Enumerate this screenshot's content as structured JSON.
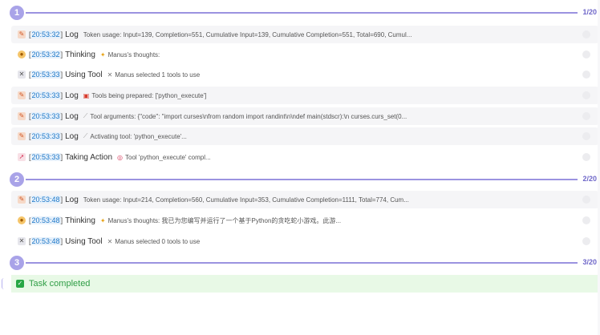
{
  "steps": [
    {
      "number": "1",
      "count": "1/20"
    },
    {
      "number": "2",
      "count": "2/20"
    },
    {
      "number": "3",
      "count": "3/20"
    }
  ],
  "rows": [
    {
      "time": "20:53:32",
      "kind": "Log",
      "icon": "log-icon",
      "msg_icon": "",
      "message": "Token usage: Input=139, Completion=551, Cumulative Input=139, Cumulative Completion=551, Total=690, Cumul..."
    },
    {
      "time": "20:53:32",
      "kind": "Thinking",
      "icon": "thinking-icon",
      "msg_icon": "sparkle-icon",
      "message": "Manus's thoughts:"
    },
    {
      "time": "20:53:33",
      "kind": "Using Tool",
      "icon": "tool-icon",
      "msg_icon": "tools-icon",
      "message": "Manus selected 1 tools to use"
    },
    {
      "time": "20:53:33",
      "kind": "Log",
      "icon": "log-icon",
      "msg_icon": "toolbox-icon",
      "message": "Tools being prepared: ['python_execute']"
    },
    {
      "time": "20:53:33",
      "kind": "Log",
      "icon": "log-icon",
      "msg_icon": "wand-icon",
      "message": "Tool arguments: {\"code\": \"import curses\\nfrom random import randint\\n\\ndef main(stdscr):\\n curses.curs_set(0..."
    },
    {
      "time": "20:53:33",
      "kind": "Log",
      "icon": "log-icon",
      "msg_icon": "wand-icon",
      "message": "Activating tool: 'python_execute'..."
    },
    {
      "time": "20:53:33",
      "kind": "Taking Action",
      "icon": "action-icon",
      "msg_icon": "target-icon",
      "message": "Tool 'python_execute' compl..."
    },
    {
      "time": "20:53:48",
      "kind": "Log",
      "icon": "log-icon",
      "msg_icon": "",
      "message": "Token usage: Input=214, Completion=560, Cumulative Input=353, Cumulative Completion=1111, Total=774, Cum..."
    },
    {
      "time": "20:53:48",
      "kind": "Thinking",
      "icon": "thinking-icon",
      "msg_icon": "sparkle-icon",
      "message": "Manus's thoughts: 我已为您编写并运行了一个基于Python的贪吃蛇小游戏。此游..."
    },
    {
      "time": "20:53:48",
      "kind": "Using Tool",
      "icon": "tool-icon",
      "msg_icon": "tools-icon",
      "message": "Manus selected 0 tools to use"
    }
  ],
  "completion": {
    "label": "Task completed"
  }
}
